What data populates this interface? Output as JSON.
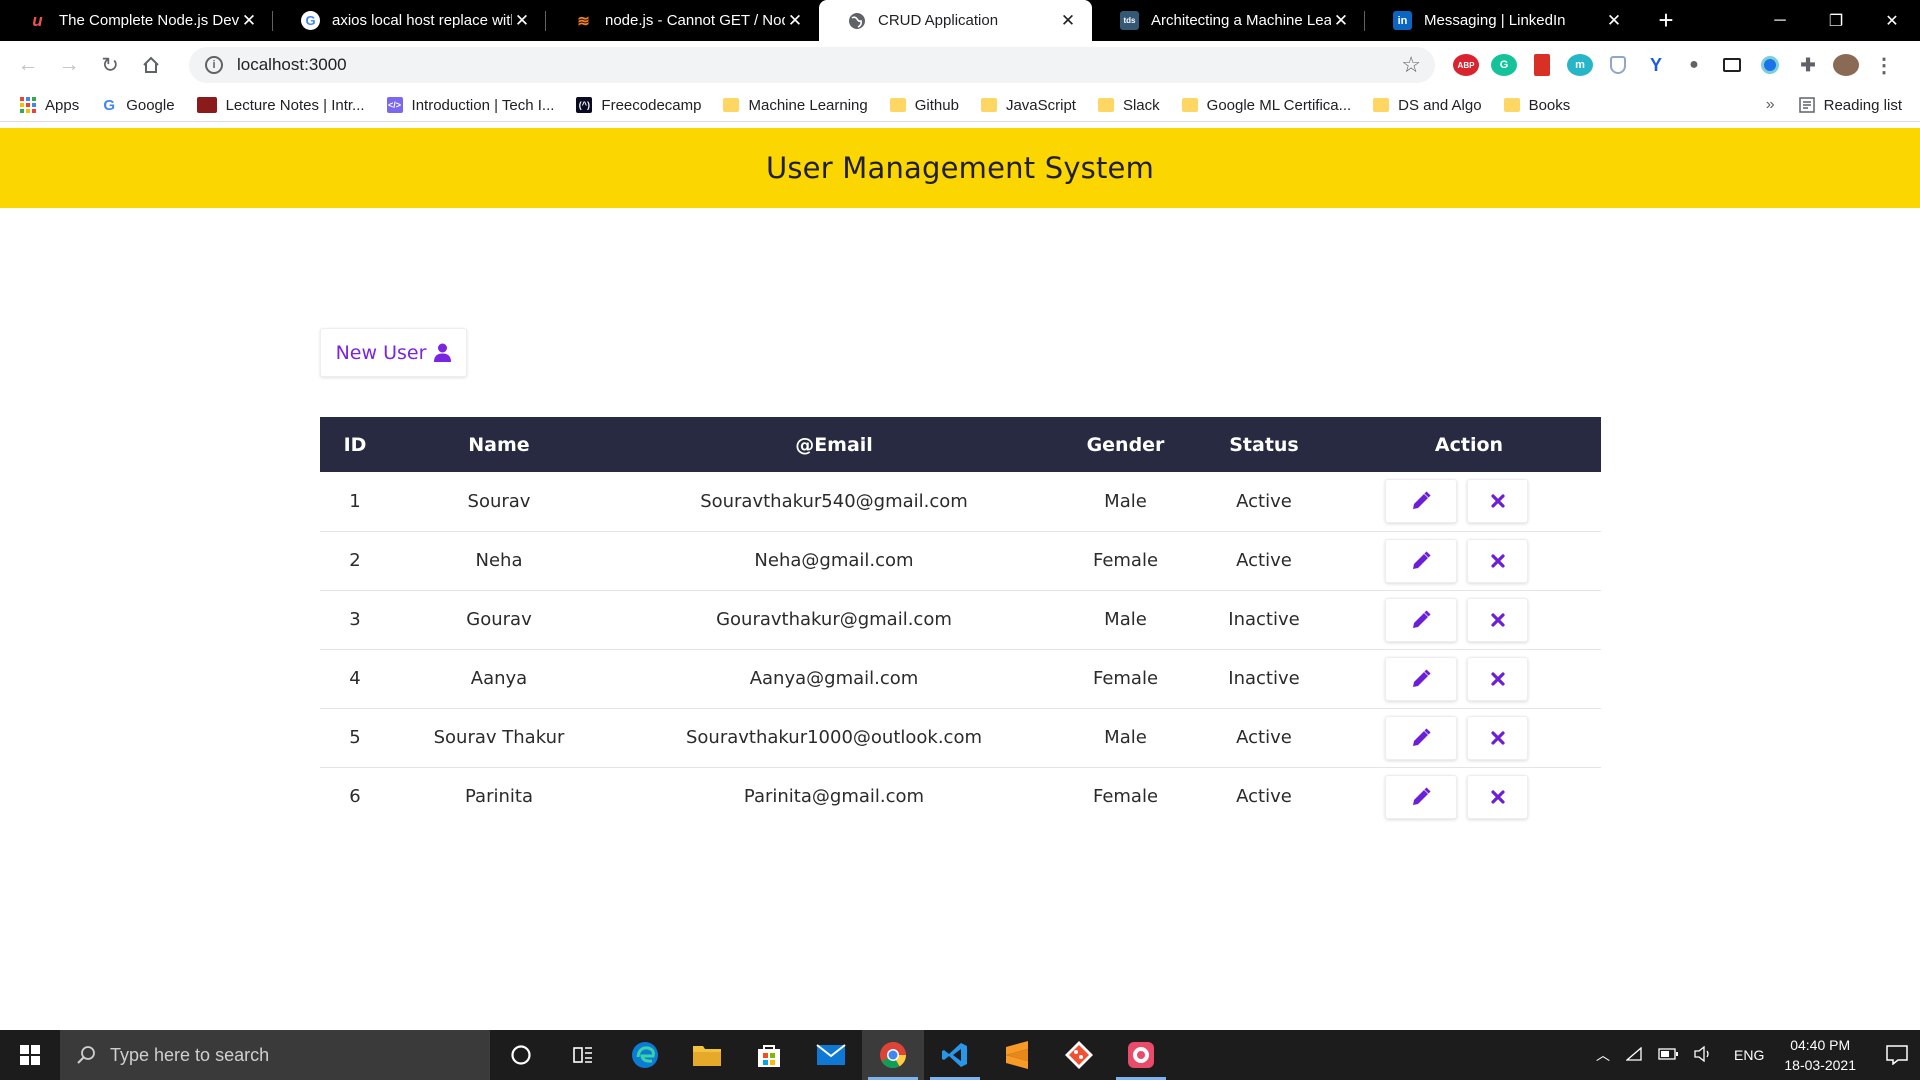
{
  "browser": {
    "tabs": [
      {
        "title": "The Complete Node.js Develo",
        "favicon": "udemy-icon",
        "active": false
      },
      {
        "title": "axios local host replace with lo",
        "favicon": "google-icon",
        "active": false
      },
      {
        "title": "node.js - Cannot GET / Node.j",
        "favicon": "stackoverflow-icon",
        "active": false
      },
      {
        "title": "CRUD Application",
        "favicon": "globe-icon",
        "active": true
      },
      {
        "title": "Architecting a Machine Learni",
        "favicon": "tds-icon",
        "active": false
      },
      {
        "title": "Messaging | LinkedIn",
        "favicon": "linkedin-icon",
        "active": false
      }
    ],
    "favicon_text": {
      "tds": "tds",
      "linkedin": "in"
    },
    "url": "localhost:3000",
    "extensions": {
      "abp": "ABP",
      "m": "m"
    },
    "bookmarks": [
      {
        "label": "Apps",
        "icon": "apps-grid-icon"
      },
      {
        "label": "Google",
        "icon": "google-icon"
      },
      {
        "label": "Lecture Notes | Intr...",
        "icon": "site-icon"
      },
      {
        "label": "Introduction | Tech I...",
        "icon": "code-icon"
      },
      {
        "label": "Freecodecamp",
        "icon": "freecodecamp-icon"
      },
      {
        "label": "Machine Learning",
        "icon": "folder-icon"
      },
      {
        "label": "Github",
        "icon": "folder-icon"
      },
      {
        "label": "JavaScript",
        "icon": "folder-icon"
      },
      {
        "label": "Slack",
        "icon": "folder-icon"
      },
      {
        "label": "Google ML Certifica...",
        "icon": "folder-icon"
      },
      {
        "label": "DS and Algo",
        "icon": "folder-icon"
      },
      {
        "label": "Books",
        "icon": "folder-icon"
      }
    ],
    "bookmarks_more": "»",
    "reading_list": "Reading list"
  },
  "app": {
    "title": "User Management System",
    "new_user_label": "New User",
    "accent": "#fbd600",
    "button_color": "#7a25e0",
    "table": {
      "headers": [
        "ID",
        "Name",
        "@Email",
        "Gender",
        "Status",
        "Action"
      ],
      "rows": [
        {
          "id": "1",
          "name": "Sourav",
          "email": "Souravthakur540@gmail.com",
          "gender": "Male",
          "status": "Active"
        },
        {
          "id": "2",
          "name": "Neha",
          "email": "Neha@gmail.com",
          "gender": "Female",
          "status": "Active"
        },
        {
          "id": "3",
          "name": "Gourav",
          "email": "Gouravthakur@gmail.com",
          "gender": "Male",
          "status": "Inactive"
        },
        {
          "id": "4",
          "name": "Aanya",
          "email": "Aanya@gmail.com",
          "gender": "Female",
          "status": "Inactive"
        },
        {
          "id": "5",
          "name": "Sourav Thakur",
          "email": "Souravthakur1000@outlook.com",
          "gender": "Male",
          "status": "Active"
        },
        {
          "id": "6",
          "name": "Parinita",
          "email": "Parinita@gmail.com",
          "gender": "Female",
          "status": "Active"
        }
      ]
    }
  },
  "taskbar": {
    "search_placeholder": "Type here to search",
    "language": "ENG",
    "time": "04:40 PM",
    "date": "18-03-2021"
  }
}
